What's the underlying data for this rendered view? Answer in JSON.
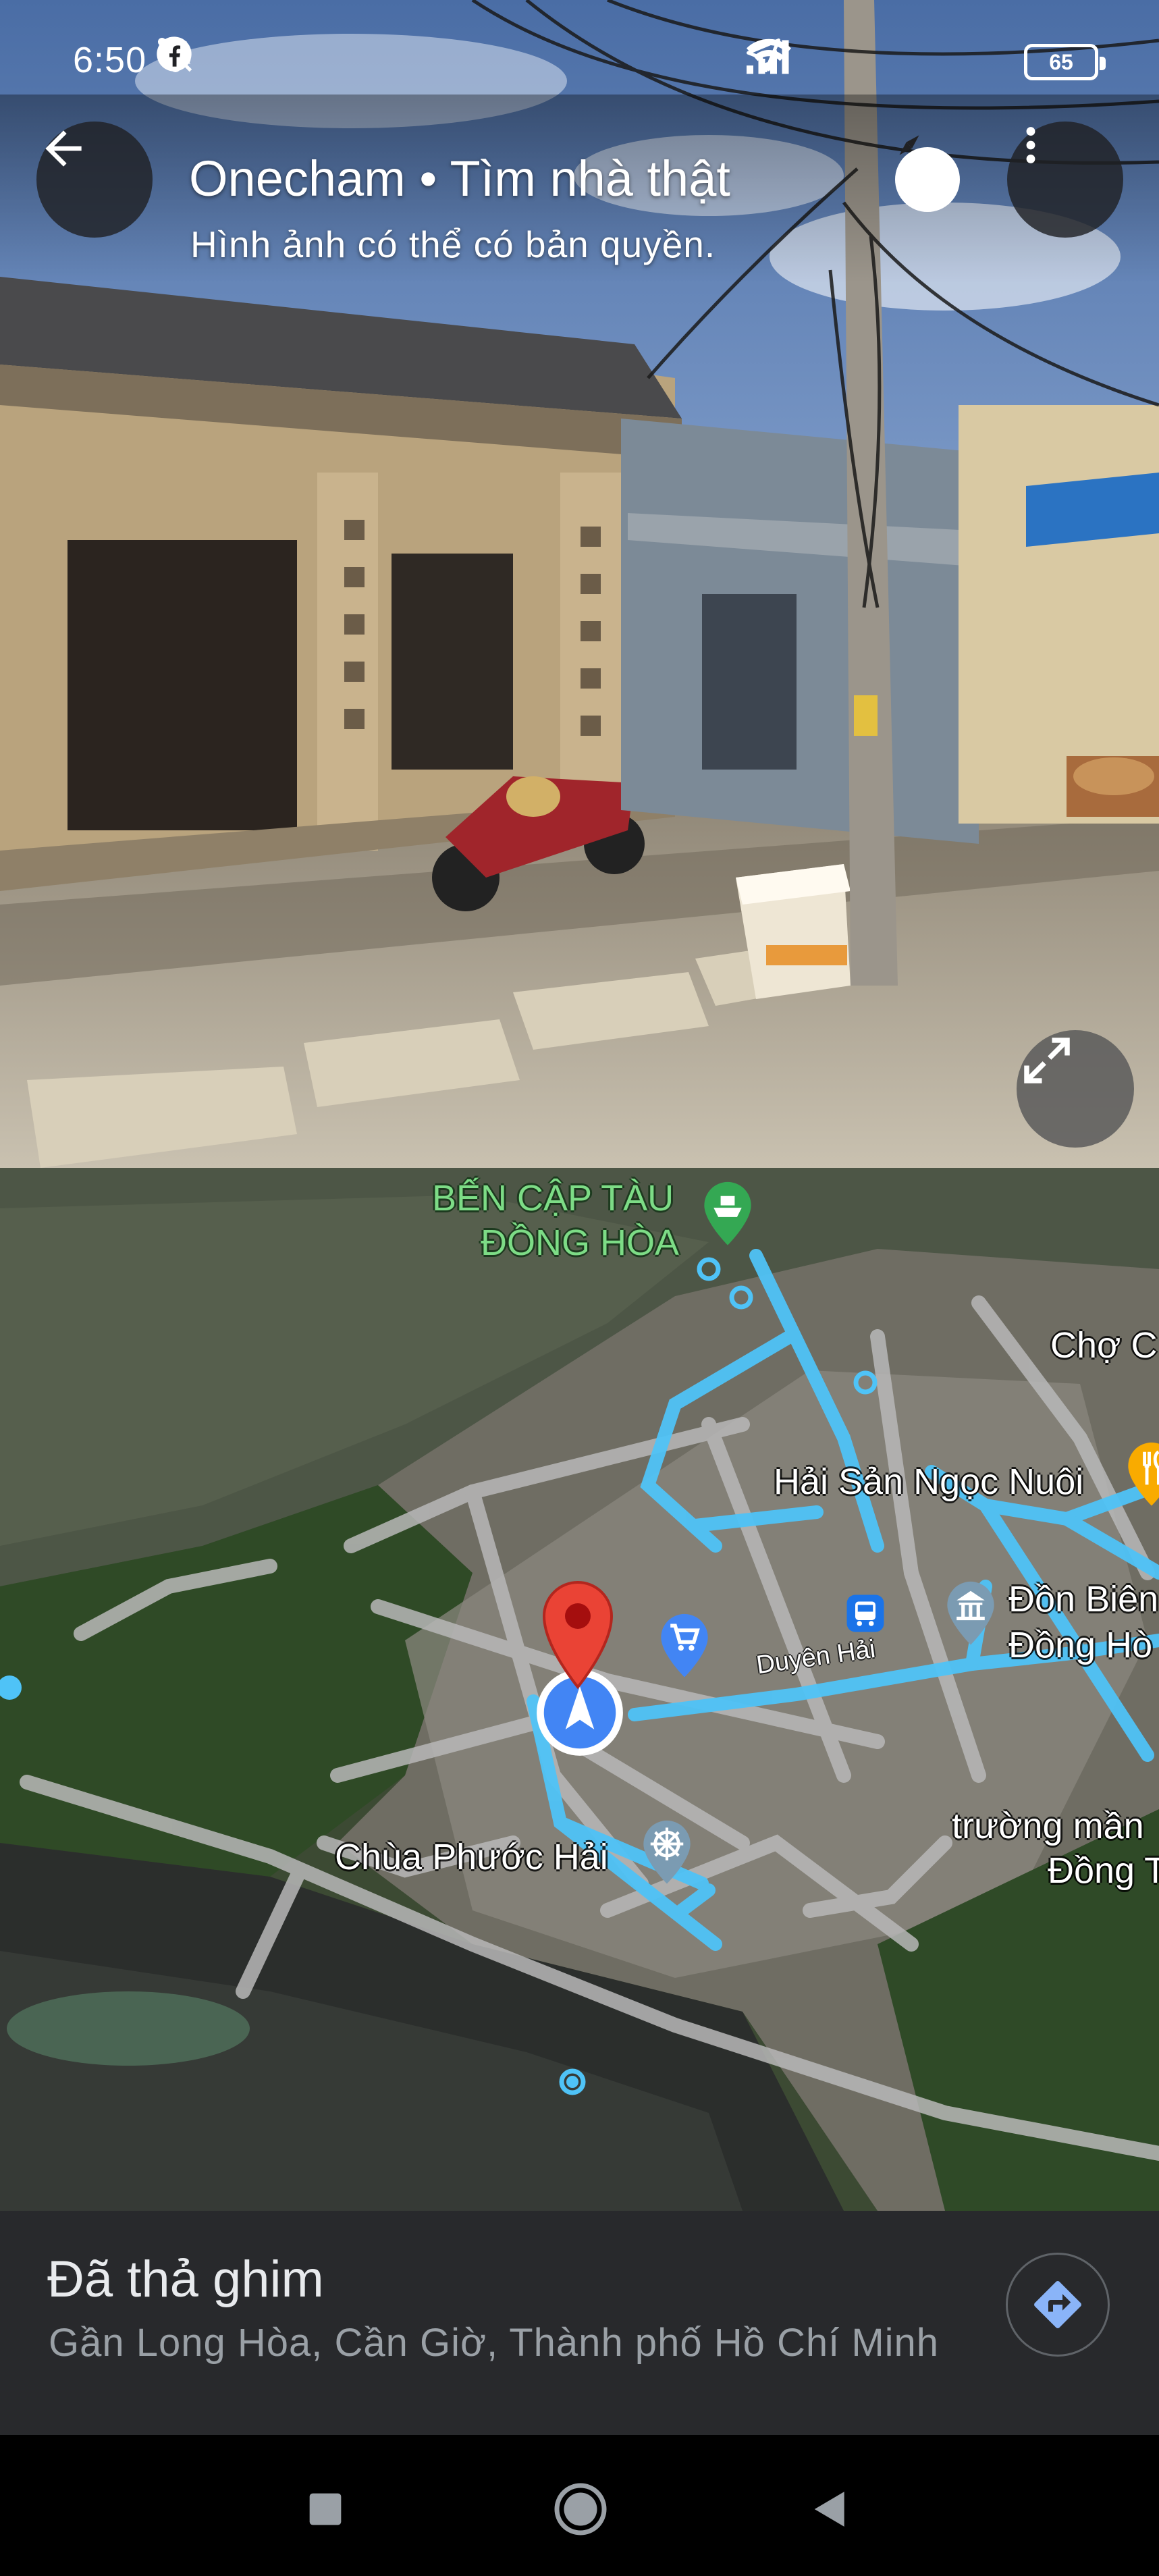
{
  "status_bar": {
    "time": "6:50",
    "battery": "65",
    "left_icons": [
      "mute-icon",
      "cloud-icon",
      "trash-icon",
      "facebook-icon",
      "dot-icon"
    ],
    "right_icons": [
      "location-arrow-icon",
      "signal-icon",
      "signal-icon",
      "wifi-icon",
      "battery-icon"
    ]
  },
  "street_view": {
    "title": "Onecham • Tìm nhà thật",
    "subtitle": "Hình ảnh có thể có bản quyền."
  },
  "map": {
    "labels": {
      "ferry_line1": "BẾN CẬP TÀU",
      "ferry_line2": "ĐỒNG HÒA",
      "market": "Chợ C",
      "seafood": "Hải Sản Ngọc Nuôi",
      "border_line1": "Đồn Biên",
      "border_line2": "Đồng Hò",
      "road": "Duyên Hải",
      "pagoda": "Chùa Phước Hải",
      "school_line1": "trường mần",
      "school_line2": "Đồng T"
    },
    "colors": {
      "route": "#4fc3f7",
      "pin": "#ea4335",
      "location": "#4285f4",
      "ferry": "#34a853",
      "food": "#f9ab00",
      "poi_gray": "#5f8ba7"
    }
  },
  "place_sheet": {
    "title": "Đã thả ghim",
    "address": "Gần Long Hòa, Cần Giờ, Thành phố Hồ Chí Minh"
  }
}
